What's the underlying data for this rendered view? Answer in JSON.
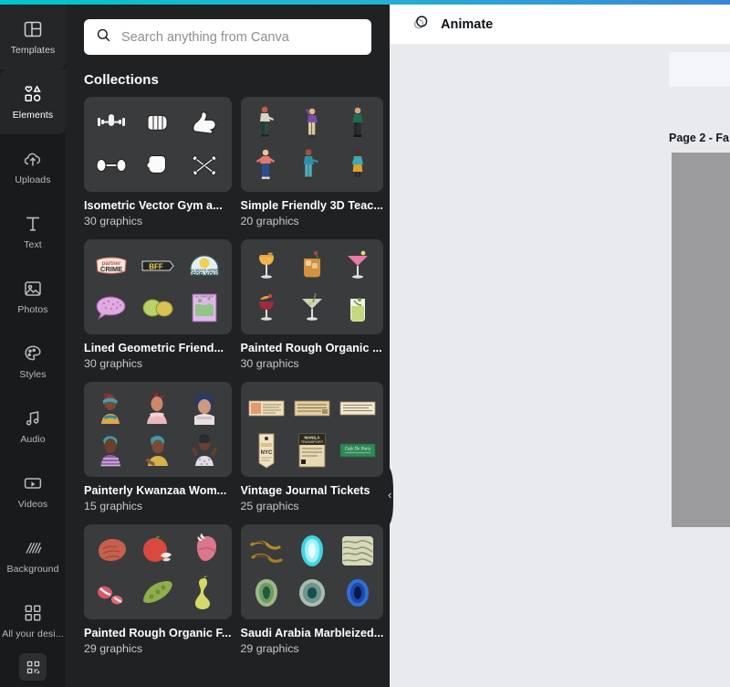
{
  "theme": {
    "accent_start": "#00c4cc",
    "accent_end": "#3a86d8",
    "rail_bg": "#181a1c",
    "panel_bg": "#1f2123",
    "card_bg": "#3a3b3d",
    "canvas_bg": "#e9eaee"
  },
  "sidebar": {
    "items": [
      {
        "label": "Templates",
        "icon": "templates-icon",
        "active": false
      },
      {
        "label": "Elements",
        "icon": "elements-icon",
        "active": true
      },
      {
        "label": "Uploads",
        "icon": "uploads-icon",
        "active": false
      },
      {
        "label": "Text",
        "icon": "text-icon",
        "active": false
      },
      {
        "label": "Photos",
        "icon": "photos-icon",
        "active": false
      },
      {
        "label": "Styles",
        "icon": "styles-icon",
        "active": false
      },
      {
        "label": "Audio",
        "icon": "audio-icon",
        "active": false
      },
      {
        "label": "Videos",
        "icon": "videos-icon",
        "active": false
      },
      {
        "label": "Background",
        "icon": "background-icon",
        "active": false
      },
      {
        "label": "All your desi...",
        "icon": "all-designs-icon",
        "active": false
      }
    ],
    "bottom_icon": "qr-code-icon"
  },
  "search": {
    "placeholder": "Search anything from Canva",
    "value": "",
    "icon": "search-icon"
  },
  "panel": {
    "section_title": "Collections",
    "collections": [
      {
        "name": "Isometric Vector Gym a...",
        "count": "30 graphics"
      },
      {
        "name": "Simple Friendly 3D Teac...",
        "count": "20 graphics"
      },
      {
        "name": "Lined Geometric Friend...",
        "count": "30 graphics"
      },
      {
        "name": "Painted Rough Organic ...",
        "count": "30 graphics"
      },
      {
        "name": "Painterly Kwanzaa Wom...",
        "count": "15 graphics"
      },
      {
        "name": "Vintage Journal Tickets",
        "count": "25 graphics"
      },
      {
        "name": "Painted Rough Organic F...",
        "count": "29 graphics"
      },
      {
        "name": "Saudi Arabia Marbleized...",
        "count": "29 graphics"
      }
    ]
  },
  "toolbar": {
    "animate_label": "Animate",
    "animate_icon": "animate-circles-icon"
  },
  "canvas": {
    "page_label": "Page 2 - Fa"
  },
  "collapse": {
    "icon": "chevron-left-icon"
  }
}
